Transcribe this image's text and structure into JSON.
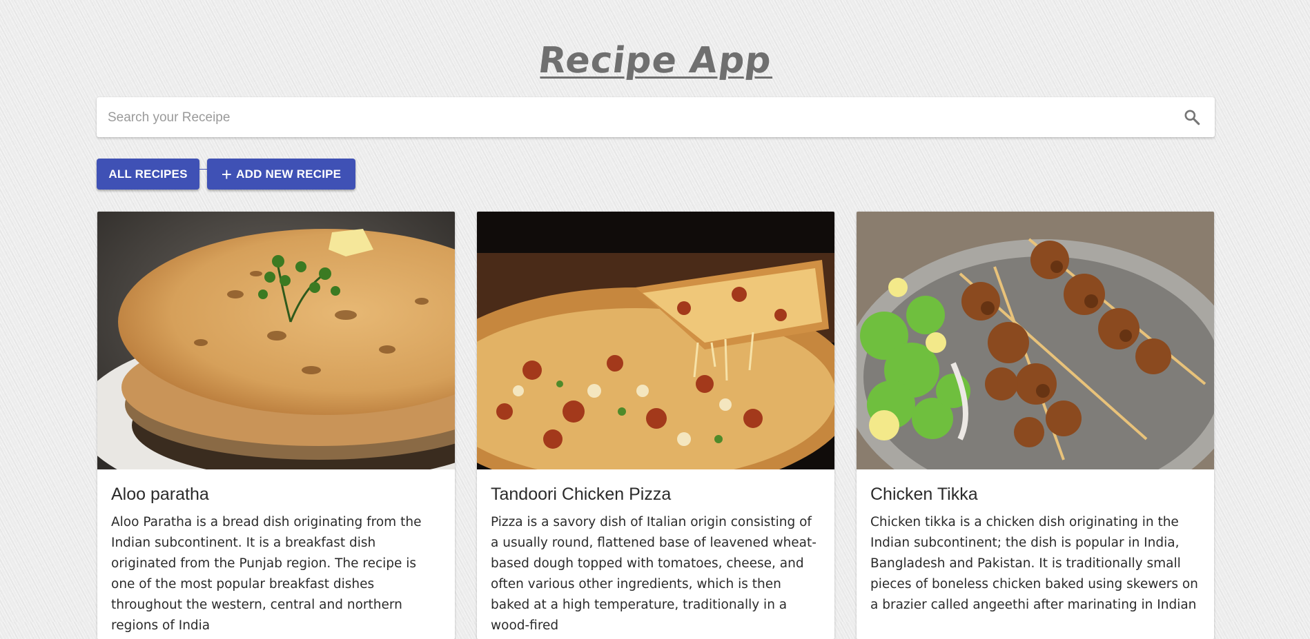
{
  "app": {
    "title": "Recipe App"
  },
  "search": {
    "placeholder": "Search your Receipe",
    "value": ""
  },
  "actions": {
    "all_label": "ALL RECIPES",
    "add_label": "ADD NEW RECIPE"
  },
  "recipes": [
    {
      "title": "Aloo paratha",
      "description": "Aloo Paratha is a bread dish originating from the Indian subcontinent. It is a breakfast dish originated from the Punjab region. The recipe is one of the most popular breakfast dishes throughout the western, central and northern regions of India"
    },
    {
      "title": "Tandoori Chicken Pizza",
      "description": "Pizza is a savory dish of Italian origin consisting of a usually round, flattened base of leavened wheat-based dough topped with tomatoes, cheese, and often various other ingredients, which is then baked at a high temperature, traditionally in a wood-fired"
    },
    {
      "title": "Chicken Tikka",
      "description": "Chicken tikka is a chicken dish originating in the Indian subcontinent; the dish is popular in India, Bangladesh and Pakistan. It is traditionally small pieces of boneless chicken baked using skewers on a brazier called angeethi after marinating in Indian"
    }
  ],
  "colors": {
    "primary": "#3f51b5",
    "title": "#6f6f6f"
  },
  "icons": {
    "search": "search-icon",
    "add": "plus-icon"
  }
}
